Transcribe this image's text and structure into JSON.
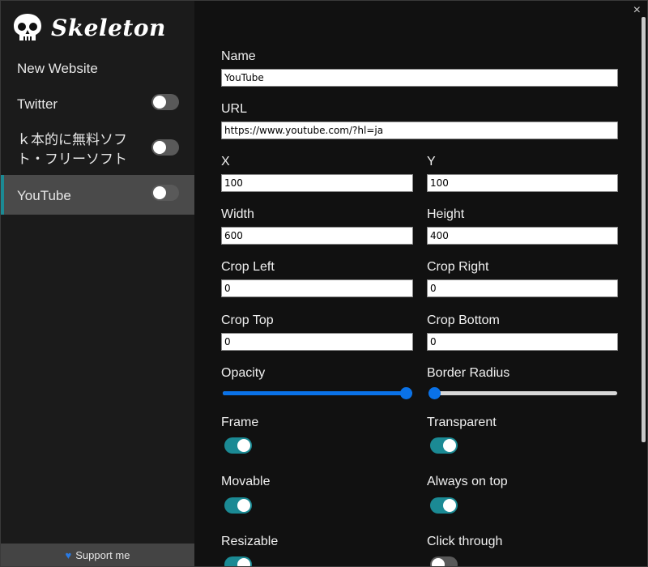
{
  "app": {
    "title": "Skeleton",
    "close_glyph": "×"
  },
  "sidebar": {
    "new_website_label": "New Website",
    "items": [
      {
        "label": "Twitter",
        "enabled": false,
        "active": false
      },
      {
        "label": "ｋ本的に無料ソフト・フリーソフト",
        "enabled": false,
        "active": false
      },
      {
        "label": "YouTube",
        "enabled": false,
        "active": true
      }
    ],
    "support_label": "Support me",
    "support_icon": "heart-icon"
  },
  "form": {
    "name": {
      "label": "Name",
      "value": "YouTube"
    },
    "url": {
      "label": "URL",
      "value": "https://www.youtube.com/?hl=ja"
    },
    "x": {
      "label": "X",
      "value": "100"
    },
    "y": {
      "label": "Y",
      "value": "100"
    },
    "width": {
      "label": "Width",
      "value": "600"
    },
    "height": {
      "label": "Height",
      "value": "400"
    },
    "crop_left": {
      "label": "Crop Left",
      "value": "0"
    },
    "crop_right": {
      "label": "Crop Right",
      "value": "0"
    },
    "crop_top": {
      "label": "Crop Top",
      "value": "0"
    },
    "crop_bottom": {
      "label": "Crop Bottom",
      "value": "0"
    },
    "opacity": {
      "label": "Opacity",
      "value": 1.0
    },
    "border_radius": {
      "label": "Border Radius",
      "value": 0.0
    },
    "frame": {
      "label": "Frame",
      "on": true
    },
    "transparent": {
      "label": "Transparent",
      "on": true
    },
    "movable": {
      "label": "Movable",
      "on": true
    },
    "always_on_top": {
      "label": "Always on top",
      "on": true
    },
    "resizable": {
      "label": "Resizable",
      "on": true
    },
    "click_through": {
      "label": "Click through",
      "on": false
    }
  },
  "colors": {
    "accent": "#1b8a94",
    "slider": "#0a72e8",
    "sidebar_bg": "#1b1b1b",
    "main_bg": "#111111"
  }
}
